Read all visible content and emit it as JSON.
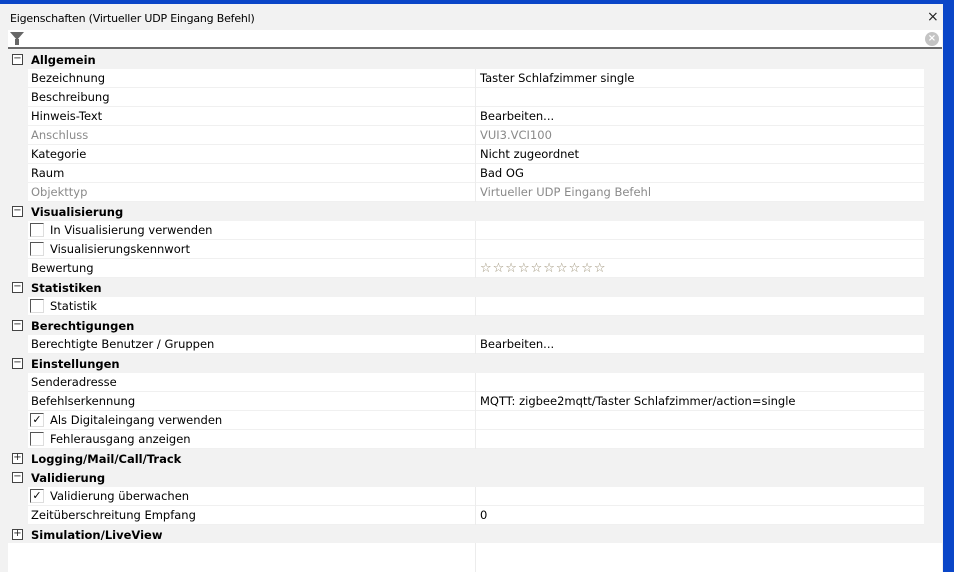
{
  "window": {
    "title": "Eigenschaften (Virtueller UDP Eingang Befehl)",
    "close_icon": "×"
  },
  "filter": {
    "value": "",
    "clear_icon": "×"
  },
  "groups": [
    {
      "label": "Allgemein",
      "expanded": true,
      "rows": [
        {
          "label": "Bezeichnung",
          "value": "Taster Schlafzimmer single"
        },
        {
          "label": "Beschreibung",
          "value": ""
        },
        {
          "label": "Hinweis-Text",
          "value": "Bearbeiten..."
        },
        {
          "label": "Anschluss",
          "value": "VUI3.VCI100",
          "disabled": true
        },
        {
          "label": "Kategorie",
          "value": "Nicht zugeordnet"
        },
        {
          "label": "Raum",
          "value": "Bad OG"
        },
        {
          "label": "Objekttyp",
          "value": "Virtueller UDP Eingang Befehl",
          "disabled": true
        }
      ]
    },
    {
      "label": "Visualisierung",
      "expanded": true,
      "rows": [
        {
          "label": "In Visualisierung verwenden",
          "checkbox": true,
          "checked": false,
          "value": ""
        },
        {
          "label": "Visualisierungskennwort",
          "checkbox": true,
          "checked": false,
          "value": ""
        },
        {
          "label": "Bewertung",
          "rating": 0,
          "rating_max": 10,
          "value": "☆☆☆☆☆☆☆☆☆☆"
        }
      ]
    },
    {
      "label": "Statistiken",
      "expanded": true,
      "rows": [
        {
          "label": "Statistik",
          "checkbox": true,
          "checked": false,
          "value": ""
        }
      ]
    },
    {
      "label": "Berechtigungen",
      "expanded": true,
      "rows": [
        {
          "label": "Berechtigte Benutzer / Gruppen",
          "value": "Bearbeiten..."
        }
      ]
    },
    {
      "label": "Einstellungen",
      "expanded": true,
      "rows": [
        {
          "label": "Senderadresse",
          "value": ""
        },
        {
          "label": "Befehlserkennung",
          "value": "MQTT: zigbee2mqtt/Taster Schlafzimmer/action=single"
        },
        {
          "label": "Als Digitaleingang verwenden",
          "checkbox": true,
          "checked": true,
          "value": ""
        },
        {
          "label": "Fehlerausgang anzeigen",
          "checkbox": true,
          "checked": false,
          "value": ""
        }
      ]
    },
    {
      "label": "Logging/Mail/Call/Track",
      "expanded": false,
      "rows": []
    },
    {
      "label": "Validierung",
      "expanded": true,
      "rows": [
        {
          "label": "Validierung überwachen",
          "checkbox": true,
          "checked": true,
          "value": ""
        },
        {
          "label": "Zeitüberschreitung Empfang",
          "value": "0"
        }
      ]
    },
    {
      "label": "Simulation/LiveView",
      "expanded": false,
      "rows": []
    }
  ]
}
